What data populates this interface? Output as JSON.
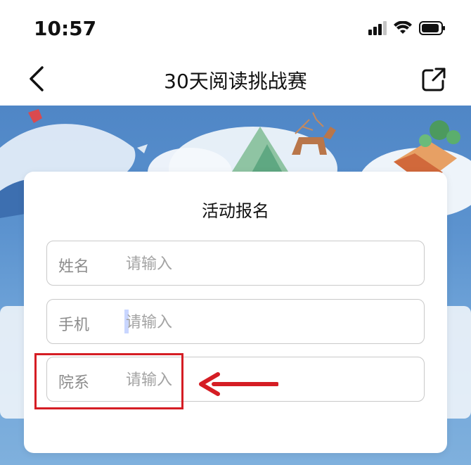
{
  "status_bar": {
    "time": "10:57"
  },
  "nav": {
    "title": "30天阅读挑战赛"
  },
  "modal": {
    "title": "活动报名",
    "fields": [
      {
        "label": "姓名",
        "placeholder": "请输入"
      },
      {
        "label": "手机",
        "placeholder": "请输入"
      },
      {
        "label": "院系",
        "placeholder": "请输入"
      }
    ]
  },
  "colors": {
    "annotation": "#d51d24",
    "banner": "#5c93cf"
  },
  "icons": {
    "back": "chevron-left-icon",
    "share": "share-icon",
    "signal": "signal-icon",
    "wifi": "wifi-icon",
    "battery": "battery-icon"
  }
}
